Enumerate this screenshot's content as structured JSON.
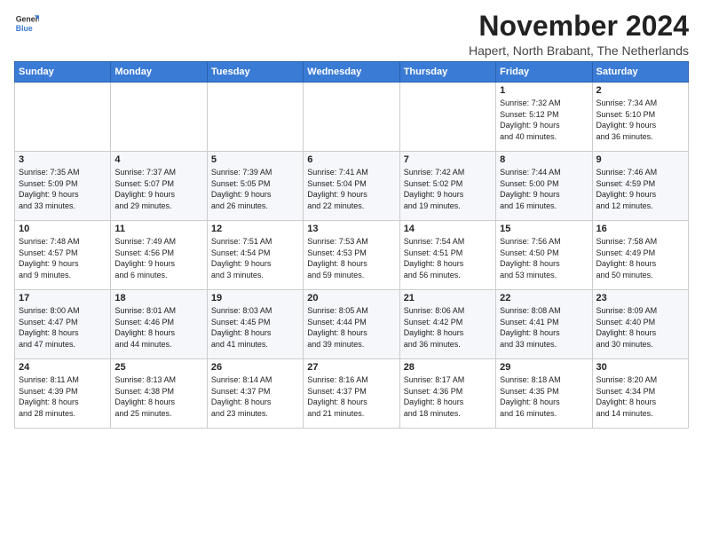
{
  "logo": {
    "general": "General",
    "blue": "Blue"
  },
  "header": {
    "title": "November 2024",
    "subtitle": "Hapert, North Brabant, The Netherlands"
  },
  "days_of_week": [
    "Sunday",
    "Monday",
    "Tuesday",
    "Wednesday",
    "Thursday",
    "Friday",
    "Saturday"
  ],
  "weeks": [
    [
      {
        "day": "",
        "detail": ""
      },
      {
        "day": "",
        "detail": ""
      },
      {
        "day": "",
        "detail": ""
      },
      {
        "day": "",
        "detail": ""
      },
      {
        "day": "",
        "detail": ""
      },
      {
        "day": "1",
        "detail": "Sunrise: 7:32 AM\nSunset: 5:12 PM\nDaylight: 9 hours\nand 40 minutes."
      },
      {
        "day": "2",
        "detail": "Sunrise: 7:34 AM\nSunset: 5:10 PM\nDaylight: 9 hours\nand 36 minutes."
      }
    ],
    [
      {
        "day": "3",
        "detail": "Sunrise: 7:35 AM\nSunset: 5:09 PM\nDaylight: 9 hours\nand 33 minutes."
      },
      {
        "day": "4",
        "detail": "Sunrise: 7:37 AM\nSunset: 5:07 PM\nDaylight: 9 hours\nand 29 minutes."
      },
      {
        "day": "5",
        "detail": "Sunrise: 7:39 AM\nSunset: 5:05 PM\nDaylight: 9 hours\nand 26 minutes."
      },
      {
        "day": "6",
        "detail": "Sunrise: 7:41 AM\nSunset: 5:04 PM\nDaylight: 9 hours\nand 22 minutes."
      },
      {
        "day": "7",
        "detail": "Sunrise: 7:42 AM\nSunset: 5:02 PM\nDaylight: 9 hours\nand 19 minutes."
      },
      {
        "day": "8",
        "detail": "Sunrise: 7:44 AM\nSunset: 5:00 PM\nDaylight: 9 hours\nand 16 minutes."
      },
      {
        "day": "9",
        "detail": "Sunrise: 7:46 AM\nSunset: 4:59 PM\nDaylight: 9 hours\nand 12 minutes."
      }
    ],
    [
      {
        "day": "10",
        "detail": "Sunrise: 7:48 AM\nSunset: 4:57 PM\nDaylight: 9 hours\nand 9 minutes."
      },
      {
        "day": "11",
        "detail": "Sunrise: 7:49 AM\nSunset: 4:56 PM\nDaylight: 9 hours\nand 6 minutes."
      },
      {
        "day": "12",
        "detail": "Sunrise: 7:51 AM\nSunset: 4:54 PM\nDaylight: 9 hours\nand 3 minutes."
      },
      {
        "day": "13",
        "detail": "Sunrise: 7:53 AM\nSunset: 4:53 PM\nDaylight: 8 hours\nand 59 minutes."
      },
      {
        "day": "14",
        "detail": "Sunrise: 7:54 AM\nSunset: 4:51 PM\nDaylight: 8 hours\nand 56 minutes."
      },
      {
        "day": "15",
        "detail": "Sunrise: 7:56 AM\nSunset: 4:50 PM\nDaylight: 8 hours\nand 53 minutes."
      },
      {
        "day": "16",
        "detail": "Sunrise: 7:58 AM\nSunset: 4:49 PM\nDaylight: 8 hours\nand 50 minutes."
      }
    ],
    [
      {
        "day": "17",
        "detail": "Sunrise: 8:00 AM\nSunset: 4:47 PM\nDaylight: 8 hours\nand 47 minutes."
      },
      {
        "day": "18",
        "detail": "Sunrise: 8:01 AM\nSunset: 4:46 PM\nDaylight: 8 hours\nand 44 minutes."
      },
      {
        "day": "19",
        "detail": "Sunrise: 8:03 AM\nSunset: 4:45 PM\nDaylight: 8 hours\nand 41 minutes."
      },
      {
        "day": "20",
        "detail": "Sunrise: 8:05 AM\nSunset: 4:44 PM\nDaylight: 8 hours\nand 39 minutes."
      },
      {
        "day": "21",
        "detail": "Sunrise: 8:06 AM\nSunset: 4:42 PM\nDaylight: 8 hours\nand 36 minutes."
      },
      {
        "day": "22",
        "detail": "Sunrise: 8:08 AM\nSunset: 4:41 PM\nDaylight: 8 hours\nand 33 minutes."
      },
      {
        "day": "23",
        "detail": "Sunrise: 8:09 AM\nSunset: 4:40 PM\nDaylight: 8 hours\nand 30 minutes."
      }
    ],
    [
      {
        "day": "24",
        "detail": "Sunrise: 8:11 AM\nSunset: 4:39 PM\nDaylight: 8 hours\nand 28 minutes."
      },
      {
        "day": "25",
        "detail": "Sunrise: 8:13 AM\nSunset: 4:38 PM\nDaylight: 8 hours\nand 25 minutes."
      },
      {
        "day": "26",
        "detail": "Sunrise: 8:14 AM\nSunset: 4:37 PM\nDaylight: 8 hours\nand 23 minutes."
      },
      {
        "day": "27",
        "detail": "Sunrise: 8:16 AM\nSunset: 4:37 PM\nDaylight: 8 hours\nand 21 minutes."
      },
      {
        "day": "28",
        "detail": "Sunrise: 8:17 AM\nSunset: 4:36 PM\nDaylight: 8 hours\nand 18 minutes."
      },
      {
        "day": "29",
        "detail": "Sunrise: 8:18 AM\nSunset: 4:35 PM\nDaylight: 8 hours\nand 16 minutes."
      },
      {
        "day": "30",
        "detail": "Sunrise: 8:20 AM\nSunset: 4:34 PM\nDaylight: 8 hours\nand 14 minutes."
      }
    ]
  ]
}
